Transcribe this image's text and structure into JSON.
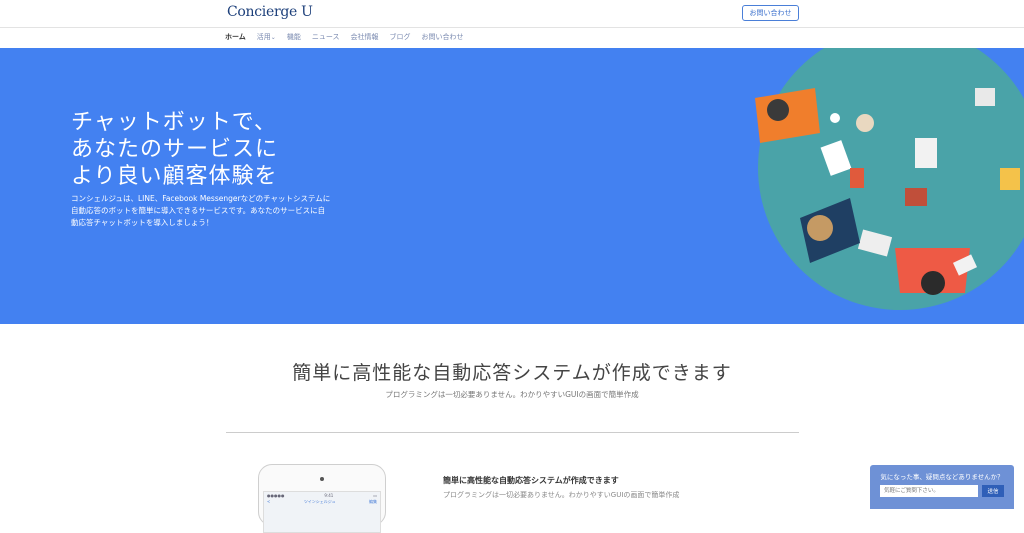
{
  "header": {
    "logo": "Concierge U",
    "contact_button": "お問い合わせ"
  },
  "nav": {
    "items": [
      {
        "label": "ホーム",
        "active": true
      },
      {
        "label": "活用",
        "has_dropdown": true
      },
      {
        "label": "機能"
      },
      {
        "label": "ニュース"
      },
      {
        "label": "会社情報"
      },
      {
        "label": "ブログ"
      },
      {
        "label": "お問い合わせ"
      }
    ]
  },
  "hero": {
    "title": "チャットボットで、\nあなたのサービスに\nより良い顧客体験を",
    "description": "コンシェルジュは、LINE、Facebook Messengerなどのチャットシステムに自動応答のボットを簡単に導入できるサービスです。あなたのサービスに自動応答チャットボットを導入しましょう！"
  },
  "section": {
    "title": "簡単に高性能な自動応答システムが作成できます",
    "subtitle": "プログラミングは一切必要ありません。わかりやすいGUIの画面で簡単作成"
  },
  "feature": {
    "title": "簡単に高性能な自動応答システムが作成できます",
    "subtitle": "プログラミングは一切必要ありません。わかりやすいGUIの画面で簡単作成"
  },
  "phone": {
    "carrier": "●●●●● ",
    "time": "9:41",
    "back": "<",
    "screen_title": "ツインシェルジュ",
    "edit": "編集"
  },
  "chat_widget": {
    "question": "気になった事、疑問点などありませんか？",
    "placeholder": "気軽にご質問下さい。",
    "send": "送信"
  },
  "colors": {
    "hero_bg": "#4381f1",
    "table_teal": "#4aa3a8",
    "accent": "#3a6fcc"
  }
}
